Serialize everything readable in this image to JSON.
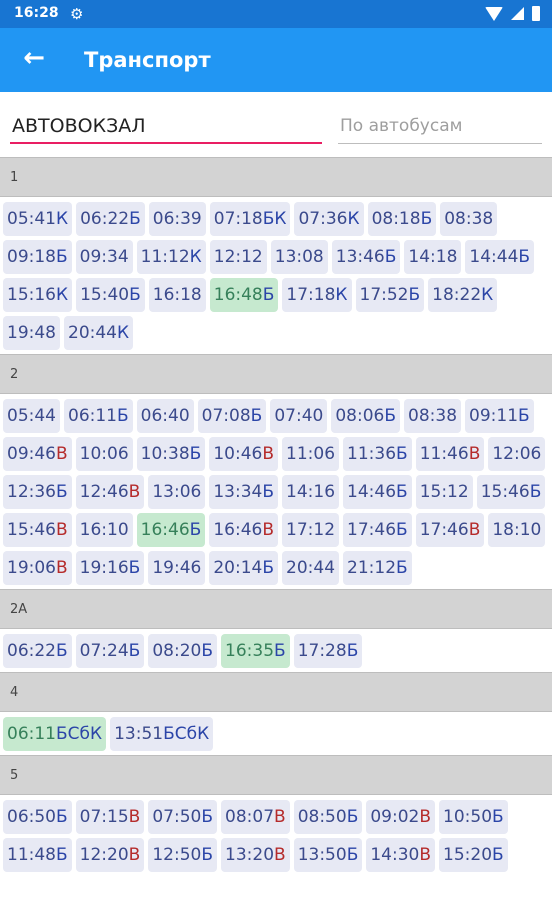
{
  "status_bar": {
    "time": "16:28",
    "icons": [
      "gear-icon",
      "wifi-icon",
      "signal-icon",
      "battery-icon"
    ]
  },
  "app_bar": {
    "title": "Транспорт",
    "back_icon": "arrow-left-icon"
  },
  "search": {
    "stop_value": "АВТОВОКЗАЛ",
    "filter_placeholder": "По автобусам"
  },
  "colors": {
    "status_bar": "#1875d2",
    "app_bar": "#2196f3",
    "accent_underline": "#e91e63",
    "chip": "#e7e9f4",
    "chip_highlight": "#c6e9cf"
  },
  "sections": [
    {
      "route": "1",
      "times": [
        {
          "t": "05:41",
          "s": "К"
        },
        {
          "t": "06:22",
          "s": "Б"
        },
        {
          "t": "06:39",
          "s": ""
        },
        {
          "t": "07:18",
          "s": "БК"
        },
        {
          "t": "07:36",
          "s": "К"
        },
        {
          "t": "08:18",
          "s": "Б"
        },
        {
          "t": "08:38",
          "s": ""
        },
        {
          "t": "09:18",
          "s": "Б"
        },
        {
          "t": "09:34",
          "s": ""
        },
        {
          "t": "11:12",
          "s": "К"
        },
        {
          "t": "12:12",
          "s": ""
        },
        {
          "t": "13:08",
          "s": ""
        },
        {
          "t": "13:46",
          "s": "Б"
        },
        {
          "t": "14:18",
          "s": ""
        },
        {
          "t": "14:44",
          "s": "Б"
        },
        {
          "t": "15:16",
          "s": "К"
        },
        {
          "t": "15:40",
          "s": "Б"
        },
        {
          "t": "16:18",
          "s": ""
        },
        {
          "t": "16:48",
          "s": "Б",
          "hl": true
        },
        {
          "t": "17:18",
          "s": "К"
        },
        {
          "t": "17:52",
          "s": "Б"
        },
        {
          "t": "18:22",
          "s": "К"
        },
        {
          "t": "19:48",
          "s": ""
        },
        {
          "t": "20:44",
          "s": "К"
        }
      ]
    },
    {
      "route": "2",
      "times": [
        {
          "t": "05:44",
          "s": ""
        },
        {
          "t": "06:11",
          "s": "Б"
        },
        {
          "t": "06:40",
          "s": ""
        },
        {
          "t": "07:08",
          "s": "Б"
        },
        {
          "t": "07:40",
          "s": ""
        },
        {
          "t": "08:06",
          "s": "Б"
        },
        {
          "t": "08:38",
          "s": ""
        },
        {
          "t": "09:11",
          "s": "Б"
        },
        {
          "t": "09:46",
          "s": "В"
        },
        {
          "t": "10:06",
          "s": ""
        },
        {
          "t": "10:38",
          "s": "Б"
        },
        {
          "t": "10:46",
          "s": "В"
        },
        {
          "t": "11:06",
          "s": ""
        },
        {
          "t": "11:36",
          "s": "Б"
        },
        {
          "t": "11:46",
          "s": "В"
        },
        {
          "t": "12:06",
          "s": ""
        },
        {
          "t": "12:36",
          "s": "Б"
        },
        {
          "t": "12:46",
          "s": "В"
        },
        {
          "t": "13:06",
          "s": ""
        },
        {
          "t": "13:34",
          "s": "Б"
        },
        {
          "t": "14:16",
          "s": ""
        },
        {
          "t": "14:46",
          "s": "Б"
        },
        {
          "t": "15:12",
          "s": ""
        },
        {
          "t": "15:46",
          "s": "Б"
        },
        {
          "t": "15:46",
          "s": "В"
        },
        {
          "t": "16:10",
          "s": ""
        },
        {
          "t": "16:46",
          "s": "Б",
          "hl": true
        },
        {
          "t": "16:46",
          "s": "В"
        },
        {
          "t": "17:12",
          "s": ""
        },
        {
          "t": "17:46",
          "s": "Б"
        },
        {
          "t": "17:46",
          "s": "В"
        },
        {
          "t": "18:10",
          "s": ""
        },
        {
          "t": "19:06",
          "s": "В"
        },
        {
          "t": "19:16",
          "s": "Б"
        },
        {
          "t": "19:46",
          "s": ""
        },
        {
          "t": "20:14",
          "s": "Б"
        },
        {
          "t": "20:44",
          "s": ""
        },
        {
          "t": "21:12",
          "s": "Б"
        }
      ]
    },
    {
      "route": "2А",
      "times": [
        {
          "t": "06:22",
          "s": "Б"
        },
        {
          "t": "07:24",
          "s": "Б"
        },
        {
          "t": "08:20",
          "s": "Б"
        },
        {
          "t": "16:35",
          "s": "Б",
          "hl": true
        },
        {
          "t": "17:28",
          "s": "Б"
        }
      ]
    },
    {
      "route": "4",
      "times": [
        {
          "t": "06:11",
          "s": "БСбК",
          "hl": true
        },
        {
          "t": "13:51",
          "s": "БСбК"
        }
      ]
    },
    {
      "route": "5",
      "times": [
        {
          "t": "06:50",
          "s": "Б"
        },
        {
          "t": "07:15",
          "s": "В"
        },
        {
          "t": "07:50",
          "s": "Б"
        },
        {
          "t": "08:07",
          "s": "В"
        },
        {
          "t": "08:50",
          "s": "Б"
        },
        {
          "t": "09:02",
          "s": "В"
        },
        {
          "t": "10:50",
          "s": "Б"
        },
        {
          "t": "11:48",
          "s": "Б"
        },
        {
          "t": "12:20",
          "s": "В"
        },
        {
          "t": "12:50",
          "s": "Б"
        },
        {
          "t": "13:20",
          "s": "В"
        },
        {
          "t": "13:50",
          "s": "Б"
        },
        {
          "t": "14:30",
          "s": "В"
        },
        {
          "t": "15:20",
          "s": "Б"
        }
      ]
    }
  ]
}
